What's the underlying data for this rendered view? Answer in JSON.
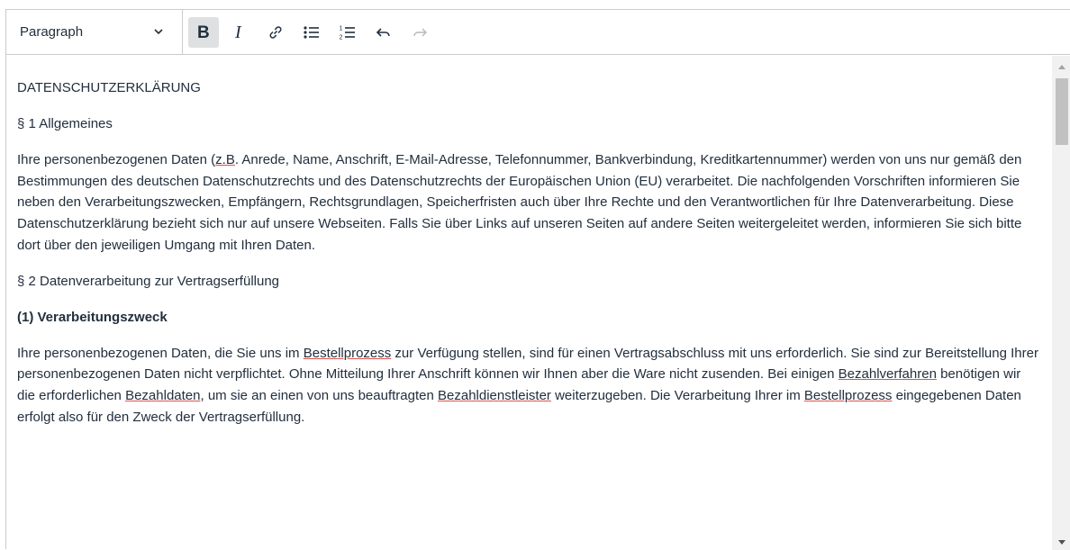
{
  "toolbar": {
    "format_value": "Paragraph",
    "buttons": [
      {
        "name": "bold-icon",
        "active": true
      },
      {
        "name": "italic-icon",
        "active": false
      },
      {
        "name": "link-icon",
        "active": false
      },
      {
        "name": "bullet-list-icon",
        "active": false
      },
      {
        "name": "numbered-list-icon",
        "active": false
      },
      {
        "name": "undo-icon",
        "active": false
      },
      {
        "name": "redo-icon",
        "active": false
      }
    ]
  },
  "document": {
    "title": "DATENSCHUTZERKLÄRUNG",
    "section1": "§ 1 Allgemeines",
    "para1_before": "Ihre personenbezogenen Daten (",
    "para1_zb": "z.B",
    "para1_after": ". Anrede, Name, Anschrift, E-Mail-Adresse, Telefonnummer, Bankverbindung, Kreditkartennummer) werden von uns nur gemäß den Bestimmungen des deutschen Datenschutzrechts und des Datenschutzrechts der Europäischen Union (EU) verarbeitet. Die nachfolgenden Vorschriften informieren Sie neben den Verarbeitungszwecken, Empfängern, Rechtsgrundlagen, Speicherfristen auch über Ihre Rechte und den Verantwortlichen für Ihre Datenverarbeitung. Diese Datenschutzerklärung bezieht sich nur auf unsere Webseiten. Falls Sie über Links auf unseren Seiten auf andere Seiten weitergeleitet werden, informieren Sie sich bitte dort über den jeweiligen Umgang mit Ihren Daten.",
    "section2": "§ 2 Datenverarbeitung zur Vertragserfüllung",
    "subheading": "(1) Verarbeitungszweck",
    "p2_a": "Ihre personenbezogenen Daten, die Sie uns im ",
    "p2_b": "Bestellprozess",
    "p2_c": " zur Verfügung stellen, sind für einen Vertragsabschluss mit uns erforderlich. Sie sind zur Bereitstellung Ihrer personenbezogenen Daten nicht verpflichtet. Ohne Mitteilung Ihrer Anschrift können wir Ihnen aber die Ware nicht zusenden. Bei einigen ",
    "p2_d": "Bezahlverfahren",
    "p2_e": " benötigen wir die erforderlichen ",
    "p2_f": "Bezahldaten",
    "p2_g": ", um sie an einen von uns beauftragten ",
    "p2_h": "Bezahldienstleister",
    "p2_i": " weiterzugeben. Die Verarbeitung Ihrer im ",
    "p2_j": "Bestellprozess",
    "p2_k": " eingegebenen Daten erfolgt also für den Zweck der Vertragserfüllung."
  }
}
